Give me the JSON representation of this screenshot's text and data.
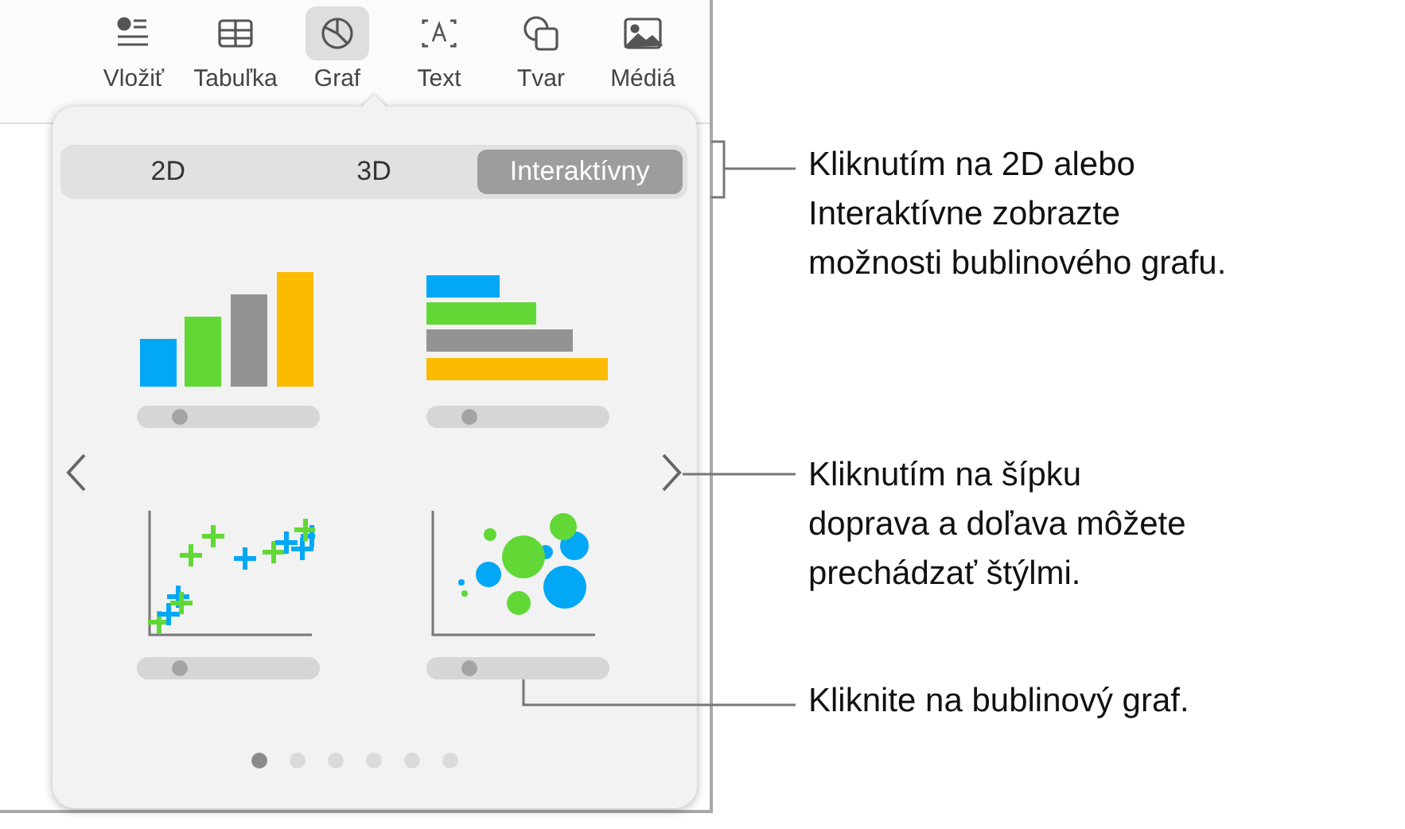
{
  "toolbar": {
    "items": [
      {
        "label": "Vložiť",
        "kind": "insert",
        "selected": false
      },
      {
        "label": "Tabuľka",
        "kind": "table",
        "selected": false
      },
      {
        "label": "Graf",
        "kind": "chart",
        "selected": true
      },
      {
        "label": "Text",
        "kind": "text",
        "selected": false
      },
      {
        "label": "Tvar",
        "kind": "shape",
        "selected": false
      },
      {
        "label": "Médiá",
        "kind": "media",
        "selected": false
      }
    ]
  },
  "popover": {
    "segments": [
      {
        "label": "2D",
        "selected": false
      },
      {
        "label": "3D",
        "selected": false
      },
      {
        "label": "Interaktívny",
        "selected": true
      }
    ],
    "styles": [
      {
        "kind": "column",
        "level": 0.2
      },
      {
        "kind": "bar",
        "level": 0.2
      },
      {
        "kind": "scatter",
        "level": 0.2
      },
      {
        "kind": "bubble",
        "level": 0.2
      }
    ],
    "pages": [
      {
        "selected": true
      },
      {
        "selected": false
      },
      {
        "selected": false
      },
      {
        "selected": false
      },
      {
        "selected": false
      },
      {
        "selected": false
      }
    ]
  },
  "callouts": [
    {
      "text": "Kliknutím na 2D alebo\nInteraktívne zobrazte\nmožnosti bublinového grafu."
    },
    {
      "text": "Kliknutím na šípku\ndoprava a doľava môžete\nprechádzať štýlmi."
    },
    {
      "text": "Kliknite na bublinový graf."
    }
  ]
}
